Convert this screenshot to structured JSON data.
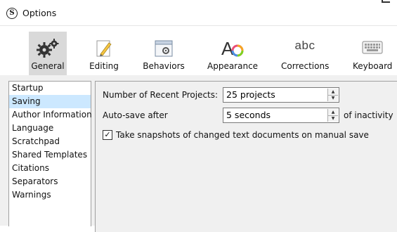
{
  "window": {
    "title": "Options",
    "logo_letter": "S"
  },
  "toolbar": {
    "items": [
      {
        "label": "General",
        "icon": "gears-icon",
        "selected": true
      },
      {
        "label": "Editing",
        "icon": "pencil-page-icon",
        "selected": false
      },
      {
        "label": "Behaviors",
        "icon": "window-gear-icon",
        "selected": false
      },
      {
        "label": "Appearance",
        "icon": "font-color-icon",
        "selected": false
      },
      {
        "label": "Corrections",
        "icon": "abc-text",
        "selected": false
      },
      {
        "label": "Keyboard",
        "icon": "keyboard-icon",
        "selected": false
      }
    ],
    "corrections_icon_text": "abc",
    "appearance_icon_text": "A"
  },
  "sidebar": {
    "items": [
      {
        "label": "Startup",
        "selected": false
      },
      {
        "label": "Saving",
        "selected": true
      },
      {
        "label": "Author Information",
        "selected": false
      },
      {
        "label": "Language",
        "selected": false
      },
      {
        "label": "Scratchpad",
        "selected": false
      },
      {
        "label": "Shared Templates",
        "selected": false
      },
      {
        "label": "Citations",
        "selected": false
      },
      {
        "label": "Separators",
        "selected": false
      },
      {
        "label": "Warnings",
        "selected": false
      }
    ]
  },
  "saving": {
    "recent_projects_label": "Number of Recent Projects:",
    "recent_projects_value": "25 projects",
    "autosave_label": "Auto-save after",
    "autosave_value": "5 seconds",
    "autosave_suffix": "of inactivity",
    "snapshot_label": "Take snapshots of changed text documents on manual save",
    "snapshot_checked": true
  },
  "colors": {
    "selection": "#cce8ff",
    "toolbar_selected": "#d9d9d9",
    "panel_bg": "#f0f0f0"
  }
}
